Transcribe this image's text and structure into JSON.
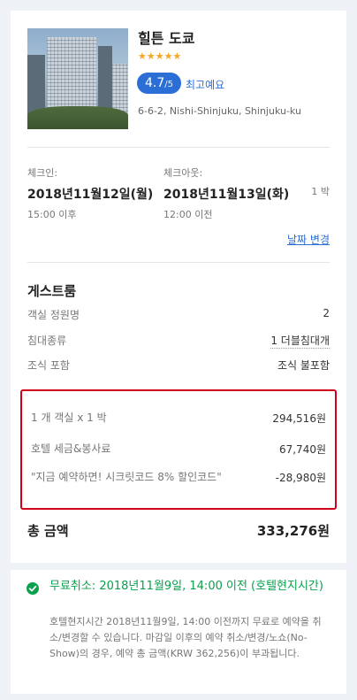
{
  "hotel": {
    "name": "힐튼 도쿄",
    "stars": "★★★★★",
    "rating_value": "4.7",
    "rating_max": "/5",
    "rating_text": "최고예요",
    "address": "6-6-2, Nishi-Shinjuku, Shinjuku-ku"
  },
  "dates": {
    "checkin_label": "체크인:",
    "checkin_date": "2018년11월12일(월)",
    "checkin_time": "15:00 이후",
    "checkout_label": "체크아웃:",
    "checkout_date": "2018년11월13일(화)",
    "checkout_time": "12:00 이전",
    "nights": "1 박",
    "change_link": "날짜 변경"
  },
  "room": {
    "title": "게스트룸",
    "rows": [
      {
        "label": "객실 정원명",
        "value": "2"
      },
      {
        "label": "침대종류",
        "value": "1 더블침대개"
      },
      {
        "label": "조식 포함",
        "value": "조식 불포함"
      }
    ]
  },
  "price": {
    "rows": [
      {
        "label": "1 개 객실 x 1 박",
        "value": "294,516원"
      },
      {
        "label": "호텔 세금&봉사료",
        "value": "67,740원"
      },
      {
        "label": "\"지금 예약하면! 시크릿코드 8% 할인코드\"",
        "value": "-28,980원"
      }
    ],
    "total_label": "총 금액",
    "total_value": "333,276원"
  },
  "cancellation": {
    "title": "무료취소: 2018년11월9일, 14:00 이전 (호텔현지시간)",
    "description": "호텔현지시간 2018년11월9일, 14:00 이전까지 무료로 예약을 취소/변경할 수 있습니다. 마감일 이후의 예약 취소/변경/노쇼(No-Show)의 경우, 예약 총 금액(KRW 362,256)이 부과됩니다."
  },
  "colors": {
    "accent_blue": "#2b6fd6",
    "highlight_red": "#d0021b",
    "success_green": "#0aa04e",
    "star_orange": "#f5a623"
  }
}
